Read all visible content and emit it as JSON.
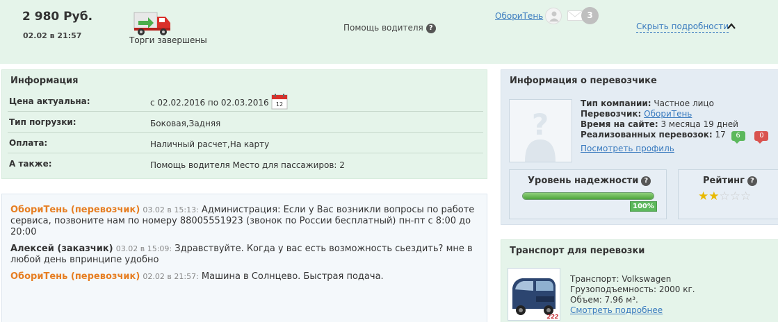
{
  "header": {
    "price": "2 980 Руб.",
    "date": "02.02 в 21:57",
    "auction_status": "Торги завершены",
    "driver_help": "Помощь водителя",
    "user_link": "ОбориТень",
    "mail_count": "3",
    "hide_details": "Скрыть подробности"
  },
  "info": {
    "title": "Информация",
    "rows": [
      {
        "label": "Цена актуальна:",
        "value": "с 02.02.2016 по 02.03.2016"
      },
      {
        "label": "Тип погрузки:",
        "value": "Боковая,Задняя"
      },
      {
        "label": "Оплата:",
        "value": "Наличный расчет,На карту"
      },
      {
        "label": "А также:",
        "value": "Помощь водителя Место для пассажиров: 2"
      }
    ],
    "calendar_day": "12"
  },
  "messages": [
    {
      "author": "ОбориТень (перевозчик)",
      "time": "03.02 в 15:13:",
      "text": "Администрация: Если у Вас возникли вопросы по работе сервиса, позвоните нам по номеру 88005551923 (звонок по России бесплатный) пн-пт с 8:00 до 20:00"
    },
    {
      "author": "Алексей (заказчик)",
      "time": "03.02 в 15:09:",
      "text": "Здравствуйте. Когда у вас есть возможность сьездить? мне в любой день впринципе удобно"
    },
    {
      "author": "ОбориТень (перевозчик)",
      "time": "02.02 в 21:57:",
      "text": "Машина в Солнцево. Быстрая подача."
    }
  ],
  "carrier": {
    "title": "Информация о перевозчике",
    "company_type_label": "Тип компании:",
    "company_type": "Частное лицо",
    "carrier_label": "Перевозчик:",
    "carrier_name": "ОбориТень",
    "time_label": "Время на сайте:",
    "time_value": "3 месяца 19 дней",
    "done_label": "Реализованных перевозок:",
    "done_value": "17",
    "positive": "6",
    "negative": "0",
    "profile_link": "Посмотреть профиль",
    "reliability_title": "Уровень надежности",
    "reliability_percent": "100%",
    "reliability_fraction": 1.0,
    "rating_title": "Рейтинг",
    "rating_value": 2,
    "rating_max": 5
  },
  "transport": {
    "title": "Транспорт для перевозки",
    "vehicle": "Транспорт: Volkswagen",
    "capacity": "Грузоподъемность: 2000 кг.",
    "volume": "Объем: 7.96 м³.",
    "more_link": "Смотреть подробнее",
    "plate_tag": "222"
  },
  "colors": {
    "green_bg": "#e5f4ea",
    "blue_bg": "#e4ecf3",
    "link": "#3a7bbf",
    "author": "#e67e22"
  }
}
